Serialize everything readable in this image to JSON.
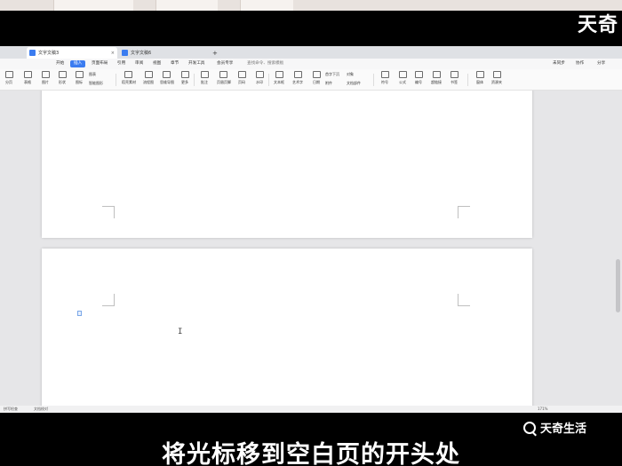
{
  "brand": {
    "name": "天奇生活",
    "top_mark": "天奇"
  },
  "caption": "将光标移到空白页的开头处",
  "tabs": [
    {
      "label": "文字文稿3",
      "active": true
    },
    {
      "label": "文字文稿6",
      "active": false
    }
  ],
  "menu": {
    "items": [
      "开始",
      "插入",
      "页面布局",
      "引用",
      "审阅",
      "视图",
      "章节",
      "开发工具",
      "会员专享"
    ],
    "active": "插入",
    "search_placeholder": "查找命令、搜索模板",
    "right": [
      "未同步",
      "协作",
      "分享"
    ]
  },
  "toolbar": {
    "buttons": [
      "分页",
      "表格",
      "图片",
      "形状",
      "图标",
      "稻壳素材",
      "流程图",
      "思维导图",
      "更多",
      "批注",
      "页眉页脚",
      "页码",
      "水印",
      "文本框",
      "艺术字",
      "日期",
      "附件",
      "文档部件",
      "符号",
      "公式",
      "编号",
      "超链接",
      "书签",
      "窗体",
      "资源夹"
    ],
    "extra": [
      "图表",
      "智能图形",
      "首字下沉",
      "对象"
    ]
  },
  "status": {
    "left": "拼写检查",
    "left2": "文档校对",
    "zoom": "171%"
  },
  "colors": {
    "accent": "#3b7cf0"
  }
}
